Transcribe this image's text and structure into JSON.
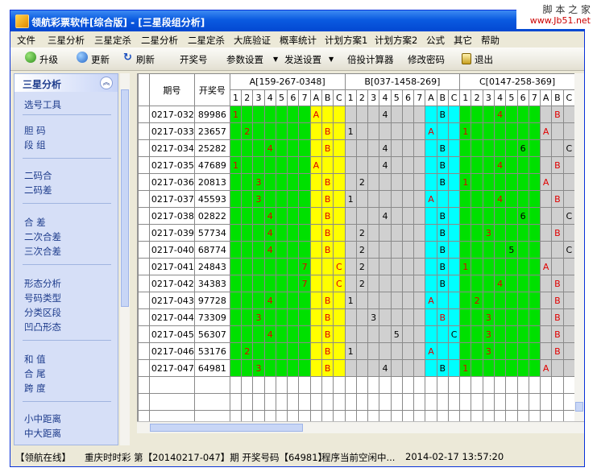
{
  "window": {
    "title": "领航彩票软件[综合版] - [三星段组分析]"
  },
  "watermark": {
    "line1": "脚 本 之 家",
    "line2": "www.Jb51.net"
  },
  "menu": [
    "文件",
    "三星分析",
    "三星定杀",
    "二星分析",
    "二星定杀",
    "大底验证",
    "概率统计",
    "计划方案1",
    "计划方案2",
    "公式",
    "其它",
    "帮助"
  ],
  "toolbar": {
    "upgrade": "升级",
    "update": "更新",
    "refresh": "刷新",
    "draw_no": "开奖号",
    "params": "参数设置",
    "send": "发送设置",
    "calc": "倍投计算器",
    "pwd": "修改密码",
    "exit": "退出"
  },
  "sidebar": {
    "header": "三星分析",
    "items": [
      "选号工具",
      "胆    码",
      "段    组",
      "二码合",
      "二码差",
      "合    差",
      "二次合差",
      "三次合差",
      "形态分析",
      "号码类型",
      "分类区段",
      "凹凸形态",
      "和    值",
      "合    尾",
      "跨    度",
      "小中距离",
      "中大距离"
    ]
  },
  "grid": {
    "col_period": "期号",
    "col_draw": "开奖号",
    "groups": [
      "A[159-267-0348]",
      "B[037-1458-269]",
      "C[0147-258-369]"
    ],
    "sub_headers": [
      "1",
      "2",
      "3",
      "4",
      "5",
      "6",
      "7",
      "A",
      "B",
      "C"
    ],
    "rows": [
      {
        "period": "0217-032",
        "draw": "89986",
        "a": [
          1,
          "A"
        ],
        "b": [
          4,
          "B"
        ],
        "c": [
          4,
          "B"
        ]
      },
      {
        "period": "0217-033",
        "draw": "23657",
        "a": [
          2,
          "B"
        ],
        "b": [
          1,
          "A"
        ],
        "c": [
          1,
          "A"
        ]
      },
      {
        "period": "0217-034",
        "draw": "25282",
        "a": [
          4,
          "B"
        ],
        "b": [
          4,
          "B"
        ],
        "c": [
          6,
          "C"
        ]
      },
      {
        "period": "0217-035",
        "draw": "47689",
        "a": [
          1,
          "A"
        ],
        "b": [
          4,
          "B"
        ],
        "c": [
          4,
          "B"
        ]
      },
      {
        "period": "0217-036",
        "draw": "20813",
        "a": [
          3,
          "B"
        ],
        "b": [
          2,
          "B"
        ],
        "c": [
          1,
          "A"
        ]
      },
      {
        "period": "0217-037",
        "draw": "45593",
        "a": [
          3,
          "B"
        ],
        "b": [
          1,
          "A"
        ],
        "c": [
          4,
          "B"
        ]
      },
      {
        "period": "0217-038",
        "draw": "02822",
        "a": [
          4,
          "B"
        ],
        "b": [
          4,
          "B"
        ],
        "c": [
          6,
          "C"
        ]
      },
      {
        "period": "0217-039",
        "draw": "57734",
        "a": [
          4,
          "B"
        ],
        "b": [
          2,
          "B"
        ],
        "c": [
          3,
          "B"
        ]
      },
      {
        "period": "0217-040",
        "draw": "68774",
        "a": [
          4,
          "B"
        ],
        "b": [
          2,
          "B"
        ],
        "c": [
          5,
          "C"
        ]
      },
      {
        "period": "0217-041",
        "draw": "24843",
        "a": [
          7,
          "C"
        ],
        "b": [
          2,
          "B"
        ],
        "c": [
          1,
          "A"
        ]
      },
      {
        "period": "0217-042",
        "draw": "34383",
        "a": [
          7,
          "C"
        ],
        "b": [
          2,
          "B"
        ],
        "c": [
          4,
          "B"
        ]
      },
      {
        "period": "0217-043",
        "draw": "97728",
        "a": [
          4,
          "B"
        ],
        "b": [
          1,
          "A"
        ],
        "c": [
          2,
          "B"
        ]
      },
      {
        "period": "0217-044",
        "draw": "73309",
        "a": [
          3,
          "B"
        ],
        "b": [
          3,
          "B"
        ],
        "c": [
          3,
          "B"
        ]
      },
      {
        "period": "0217-045",
        "draw": "56307",
        "a": [
          4,
          "B"
        ],
        "b": [
          5,
          "C"
        ],
        "c": [
          3,
          "B"
        ]
      },
      {
        "period": "0217-046",
        "draw": "53176",
        "a": [
          2,
          "B"
        ],
        "b": [
          1,
          "A"
        ],
        "c": [
          3,
          "B"
        ]
      },
      {
        "period": "0217-047",
        "draw": "64981",
        "a": [
          3,
          "B"
        ],
        "b": [
          4,
          "B"
        ],
        "c": [
          1,
          "A"
        ]
      }
    ]
  },
  "status": {
    "online": "【领航在线】",
    "lottery": "重庆时时彩 第【20140217-047】期 开奖号码【64981】",
    "state": "程序当前空闲中...",
    "time": "2014-02-17 13:57:20"
  }
}
